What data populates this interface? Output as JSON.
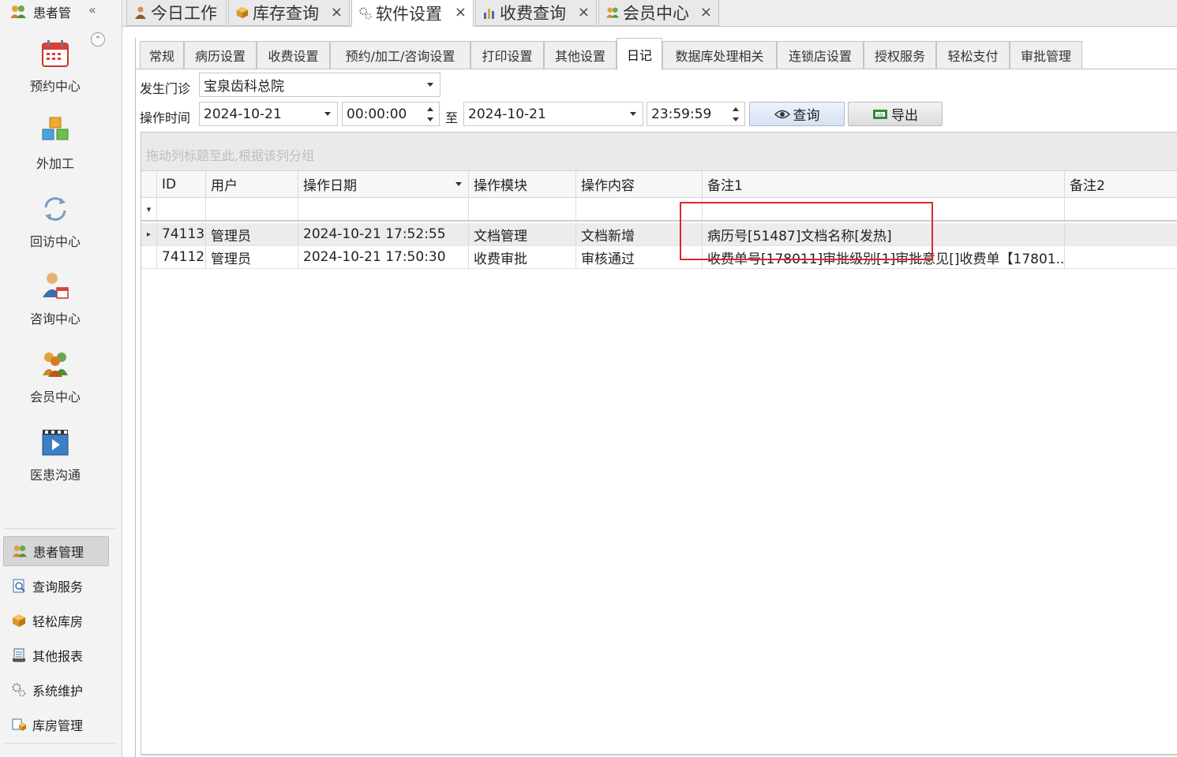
{
  "sidebar": {
    "header_title": "患者管\u0002",
    "header_title_display": "患者管",
    "collapse_label": "«",
    "circle_label": "⌃",
    "big_items": [
      {
        "label": "预约中心",
        "icon": "calendar-icon"
      },
      {
        "label": "外加工",
        "icon": "cubes-icon"
      },
      {
        "label": "回访中心",
        "icon": "refresh-icon"
      },
      {
        "label": "咨询中心",
        "icon": "consultant-icon"
      },
      {
        "label": "会员中心",
        "icon": "members-icon"
      },
      {
        "label": "医患沟通",
        "icon": "video-icon"
      }
    ],
    "small_items": [
      {
        "label": "患者管理",
        "icon": "patients-icon",
        "active": true
      },
      {
        "label": "查询服务",
        "icon": "search-doc-icon"
      },
      {
        "label": "轻松库房",
        "icon": "box-icon"
      },
      {
        "label": "其他报表",
        "icon": "report-icon"
      },
      {
        "label": "系统维护",
        "icon": "gears-icon"
      },
      {
        "label": "库房管理",
        "icon": "warehouse-icon"
      }
    ]
  },
  "doc_tabs": [
    {
      "label": "今日工作",
      "icon": "worker-icon",
      "closable": false
    },
    {
      "label": "库存查询",
      "icon": "box-icon",
      "closable": true
    },
    {
      "label": "软件设置",
      "icon": "gears-icon",
      "closable": true,
      "active": true
    },
    {
      "label": "收费查询",
      "icon": "chart-icon",
      "closable": true
    },
    {
      "label": "会员中心",
      "icon": "members-icon",
      "closable": true
    }
  ],
  "close_glyph": "×",
  "settings_tabs": [
    "常规",
    "病历设置",
    "收费设置",
    "预约/加工/咨询设置",
    "打印设置",
    "其他设置",
    "日记",
    "数据库处理相关",
    "连锁店设置",
    "授权服务",
    "轻松支付",
    "审批管理"
  ],
  "settings_active": "日记",
  "filters": {
    "clinic_label": "发生门诊",
    "clinic_value": "宝泉齿科总院",
    "time_label": "操作时间",
    "date_from": "2024-10-21",
    "time_from": "00:00:00",
    "to_label": "至",
    "date_to": "2024-10-21",
    "time_to": "23:59:59",
    "query_label": "查询",
    "export_label": "导出"
  },
  "grid": {
    "group_hint": "拖动列标题至此,根据该列分组",
    "columns": [
      "ID",
      "用户",
      "操作日期",
      "操作模块",
      "操作内容",
      "备注1",
      "备注2"
    ],
    "filter_glyph": "▾",
    "row_indicator": "▸",
    "rows": [
      [
        "74113",
        "管理员",
        "2024-10-21 17:52:55",
        "文档管理",
        "文档新增",
        "病历号[51487]文档名称[发热]",
        ""
      ],
      [
        "74112",
        "管理员",
        "2024-10-21 17:50:30",
        "收费审批",
        "审核通过",
        "收费单号[178011]审批级别[1]审批意见[]收费单【17801...",
        ""
      ]
    ]
  },
  "colors": {
    "highlight": "#d9282f",
    "accent": "#3a6fb0"
  }
}
